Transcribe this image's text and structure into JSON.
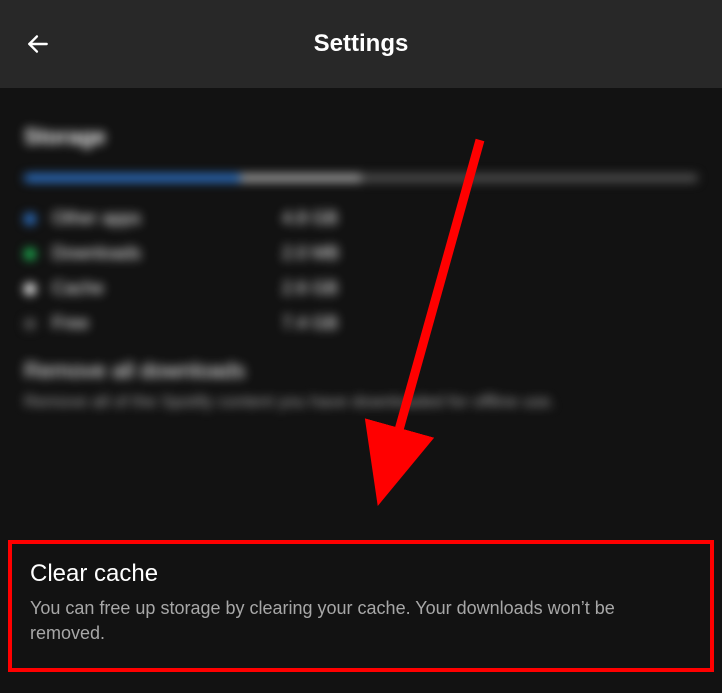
{
  "header": {
    "title": "Settings"
  },
  "storage": {
    "section_title": "Storage",
    "bar": {
      "blue_pct": 32,
      "gray_pct": 18,
      "dark_pct": 50
    },
    "legend": [
      {
        "label": "Other apps",
        "value": "4.8 GB",
        "color": "blue"
      },
      {
        "label": "Downloads",
        "value": "2.0 MB",
        "color": "green"
      },
      {
        "label": "Cache",
        "value": "2.6 GB",
        "color": "white"
      },
      {
        "label": "Free",
        "value": "7.4 GB",
        "color": "gray"
      }
    ]
  },
  "remove_downloads": {
    "title": "Remove all downloads",
    "desc": "Remove all of the Spotify content you have downloaded for offline use."
  },
  "clear_cache": {
    "title": "Clear cache",
    "desc": "You can free up storage by clearing your cache. Your downloads won’t be removed."
  }
}
